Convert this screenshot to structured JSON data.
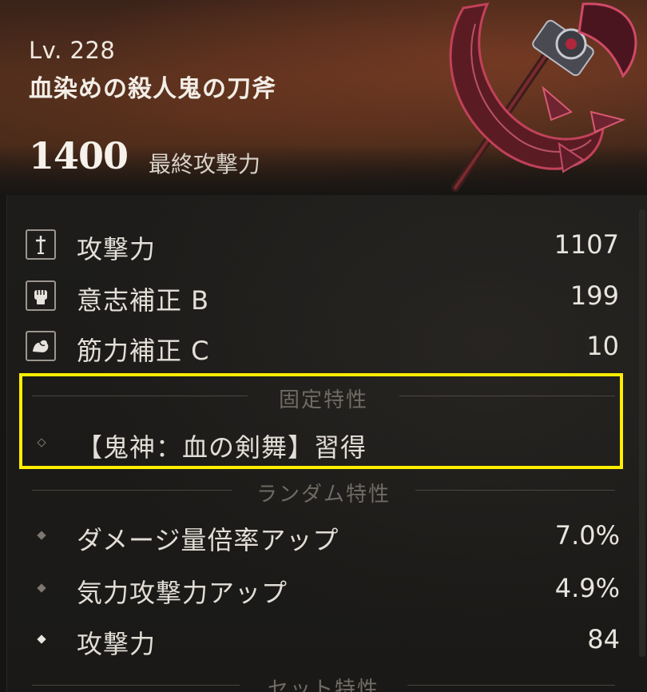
{
  "weapon": {
    "level": "Lv. 228",
    "name": "血染めの殺人鬼の刀斧",
    "power_value": "1400",
    "power_label": "最終攻撃力"
  },
  "stats": [
    {
      "icon": "sword-icon",
      "label": "攻撃力",
      "value": "1107"
    },
    {
      "icon": "fist-icon",
      "label": "意志補正 B",
      "value": "199"
    },
    {
      "icon": "muscle-arm-icon",
      "label": "筋力補正 C",
      "value": "10"
    }
  ],
  "fixed_traits": {
    "title": "固定特性",
    "items": [
      {
        "label": "【鬼神：血の剣舞】習得",
        "value": ""
      }
    ]
  },
  "random_traits": {
    "title": "ランダム特性",
    "items": [
      {
        "label": "ダメージ量倍率アップ",
        "value": "7.0%"
      },
      {
        "label": "気力攻撃力アップ",
        "value": "4.9%"
      },
      {
        "label": "攻撃力",
        "value": "84"
      }
    ]
  },
  "set_traits": {
    "title": "セット特性"
  },
  "colors": {
    "highlight": "#ffee00",
    "text": "#e4dfd8",
    "section_title": "#6f6a63",
    "bullet_dim": "#7d7770",
    "bullet_bright": "#e8e4de"
  }
}
